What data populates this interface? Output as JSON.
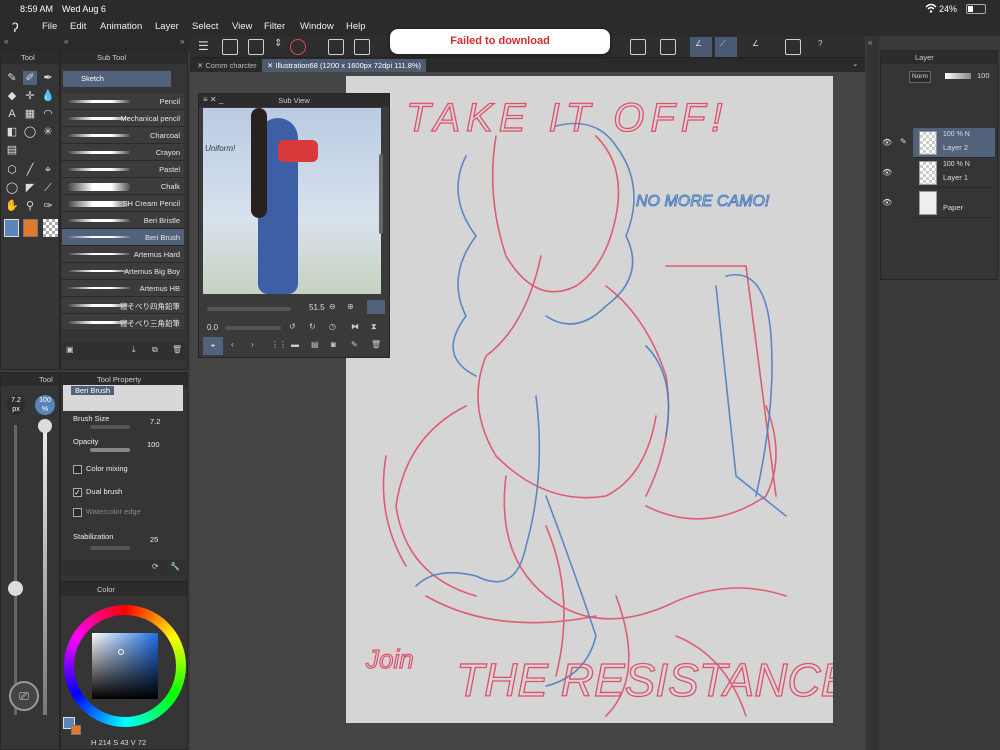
{
  "status": {
    "time": "8:59 AM",
    "date": "Wed Aug 6",
    "battery": "24%",
    "wifi_icon": "wifi-icon",
    "battery_icon": "battery-icon"
  },
  "menu": [
    "File",
    "Edit",
    "Animation",
    "Layer",
    "Select",
    "View",
    "Filter",
    "Window",
    "Help"
  ],
  "toast": "Failed to download",
  "tabs": [
    "Comm charcter",
    "Illustration68 (1200 x 1600px 72dpi 111.8%)"
  ],
  "tool_panel": {
    "title": "Tool"
  },
  "subtool_panel": {
    "title": "Sub Tool",
    "group": "Sketch",
    "items": [
      "Pencil",
      "Mechanical pencil",
      "Charcoal",
      "Crayon",
      "Pastel",
      "Chalk",
      "SH Cream Pencil",
      "Beri Bristle",
      "Beri Brush",
      "Artemus Hard",
      "Artemus Big Boy",
      "Artemus HB",
      "寝そべり四角鉛筆",
      "寝そべり三角鉛筆"
    ],
    "selected": "Beri Brush"
  },
  "subview": {
    "title": "Sub View",
    "zoom": "51.5",
    "rotation": "0.0",
    "ref_text": "Uniform!"
  },
  "brush_size_slider": {
    "size": "7.2\npx",
    "opacity": "100\n%"
  },
  "tool_property": {
    "title": "Tool Property",
    "brush_name": "Beri Brush",
    "brush_size_label": "Brush Size",
    "brush_size": "7.2",
    "opacity_label": "Opacity",
    "opacity": "100",
    "color_mixing": "Color mixing",
    "dual_brush": "Dual brush",
    "watercolor_edge": "Watercolor edge",
    "stabilization_label": "Stabilization",
    "stabilization": "25"
  },
  "color_panel": {
    "title": "Color",
    "h": "214",
    "s": "43",
    "v": "72",
    "h_label": "H",
    "s_label": "S",
    "v_label": "V",
    "main_color": "#5b84b8",
    "sub_color": "#e07a28"
  },
  "layer_panel": {
    "title": "Layer",
    "blend": "Norm",
    "opacity": "100",
    "layers": [
      {
        "opacity": "100 %  N",
        "name": "Layer 2"
      },
      {
        "opacity": "100 %  N",
        "name": "Layer 1"
      },
      {
        "opacity": "",
        "name": "Paper"
      }
    ]
  },
  "sketch_text": {
    "top": "TAKE IT OFF!",
    "side": "NO MORE CAMO!",
    "join": "Join",
    "bottom": "THE RESISTANCE"
  },
  "colors": {
    "red_pencil": "#e0506a",
    "blue_pencil": "#4f7fc0",
    "selection": "#52627a"
  }
}
